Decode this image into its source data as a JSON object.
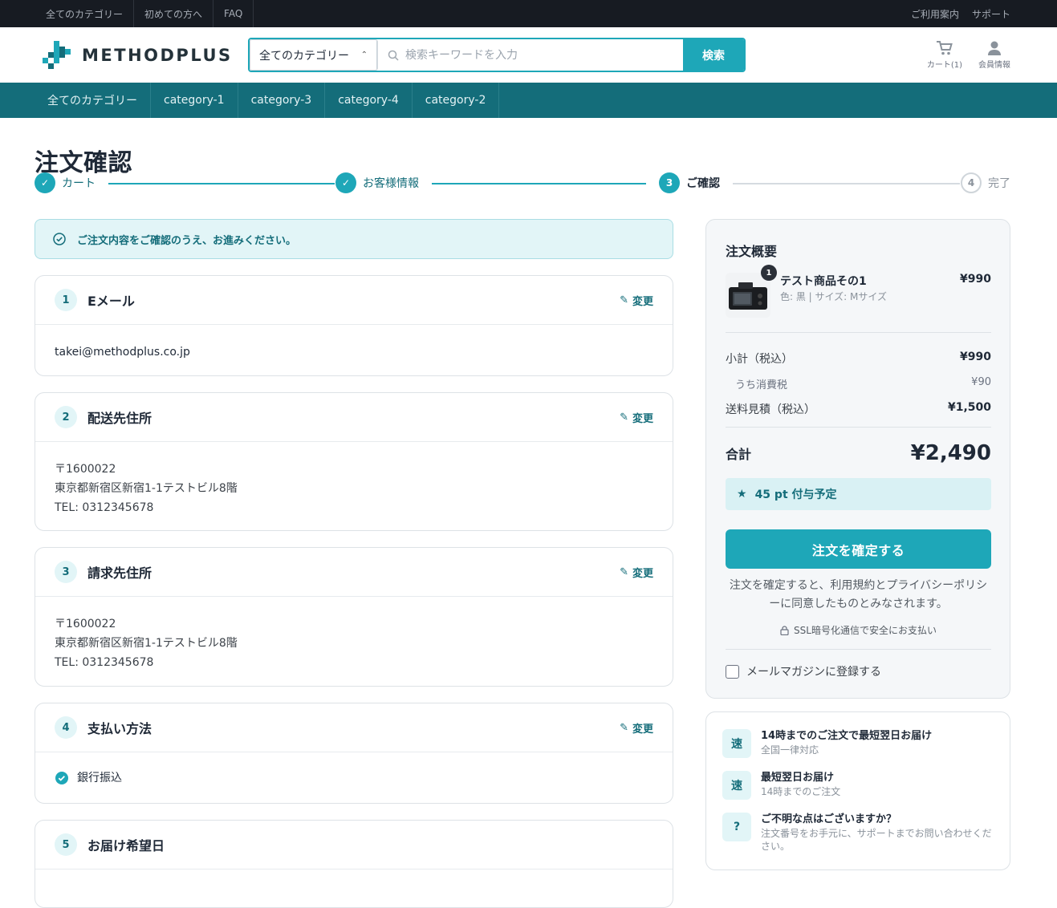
{
  "topbar": {
    "links": [
      "全てのカテゴリー",
      "初めての方へ",
      "FAQ"
    ],
    "right": [
      "ご利用案内",
      "サポート"
    ]
  },
  "header": {
    "logo_text": "METHODPLUS",
    "search_category": "全てのカテゴリー",
    "search_placeholder": "検索キーワードを入力",
    "search_button": "検索",
    "cart_label": "カート(1)",
    "member_label": "会員情報"
  },
  "catnav": [
    "全てのカテゴリー",
    "category-1",
    "category-3",
    "category-4",
    "category-2"
  ],
  "page_title": "注文確認",
  "steps": [
    {
      "num": "✓",
      "label": "カート",
      "state": "done"
    },
    {
      "num": "✓",
      "label": "お客様情報",
      "state": "done"
    },
    {
      "num": "3",
      "label": "ご確認",
      "state": "current"
    },
    {
      "num": "4",
      "label": "完了",
      "state": "todo"
    }
  ],
  "notice": "ご注文内容をご確認のうえ、お進みください。",
  "sections": {
    "email": {
      "num": "1",
      "title": "Eメール",
      "edit": "変更",
      "value": "takei@methodplus.co.jp"
    },
    "shipping": {
      "num": "2",
      "title": "配送先住所",
      "edit": "変更",
      "postal": "〒1600022",
      "address": "東京都新宿区新宿1-1テストビル8階",
      "tel": "TEL: 0312345678"
    },
    "billing": {
      "num": "3",
      "title": "請求先住所",
      "edit": "変更",
      "postal": "〒1600022",
      "address": "東京都新宿区新宿1-1テストビル8階",
      "tel": "TEL: 0312345678"
    },
    "payment": {
      "num": "4",
      "title": "支払い方法",
      "edit": "変更",
      "method": "銀行振込"
    },
    "delivery": {
      "num": "5",
      "title": "お届け希望日"
    }
  },
  "summary": {
    "title": "注文概要",
    "product": {
      "qty": "1",
      "name": "テスト商品その1",
      "variant": "色: 黒 | サイズ: Mサイズ",
      "price": "¥990"
    },
    "subtotal_label": "小計（税込）",
    "subtotal": "¥990",
    "tax_label": "うち消費税",
    "tax": "¥90",
    "shipping_label": "送料見積（税込）",
    "shipping": "¥1,500",
    "total_label": "合計",
    "total": "¥2,490",
    "points": "45 pt 付与予定",
    "confirm_button": "注文を確定する",
    "terms": "注文を確定すると、利用規約とプライバシーポリシーに同意したものとみなされます。",
    "ssl": "SSL暗号化通信で安全にお支払い",
    "newsletter": "メールマガジンに登録する"
  },
  "info": [
    {
      "badge": "速",
      "title": "14時までのご注文で最短翌日お届け",
      "desc": "全国一律対応"
    },
    {
      "badge": "速",
      "title": "最短翌日お届け",
      "desc": "14時までのご注文"
    },
    {
      "badge": "?",
      "title": "ご不明な点はございますか？",
      "desc": "注文番号をお手元に、サポートまでお問い合わせください。"
    }
  ],
  "colors": {
    "accent": "#1ea7b8",
    "dark_teal": "#146d7a",
    "topbar": "#171b22"
  }
}
